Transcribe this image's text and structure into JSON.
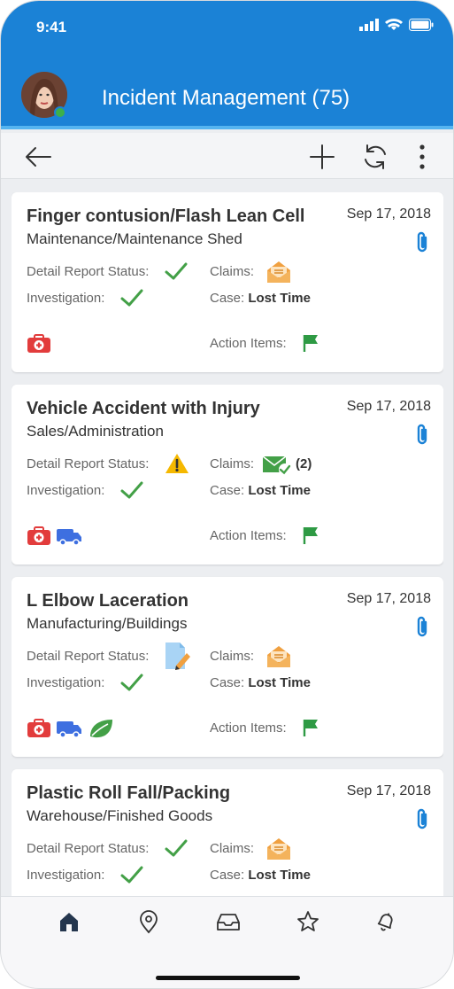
{
  "status_bar": {
    "time": "9:41"
  },
  "header": {
    "title": "Incident Management (75)"
  },
  "labels": {
    "detail_report_status": "Detail Report Status:",
    "investigation": "Investigation:",
    "claims": "Claims:",
    "case": "Case:",
    "action_items": "Action Items:"
  },
  "incidents": [
    {
      "title": "Finger contusion/Flash Lean Cell",
      "location": "Maintenance/Maintenance Shed",
      "date": "Sep 17, 2018",
      "detail_status": "complete-check",
      "claims_icon": "envelope-open-icon",
      "claims_count": "",
      "case_type": "Lost Time",
      "tags": [
        "first-aid-icon"
      ]
    },
    {
      "title": "Vehicle Accident with Injury",
      "location": "Sales/Administration",
      "date": "Sep 17, 2018",
      "detail_status": "warning",
      "claims_icon": "envelope-check-icon",
      "claims_count": "(2)",
      "case_type": "Lost Time",
      "tags": [
        "first-aid-icon",
        "truck-icon"
      ]
    },
    {
      "title": "L Elbow Laceration",
      "location": "Manufacturing/Buildings",
      "date": "Sep 17, 2018",
      "detail_status": "draft",
      "claims_icon": "envelope-open-icon",
      "claims_count": "",
      "case_type": "Lost Time",
      "tags": [
        "first-aid-icon",
        "truck-icon",
        "leaf-icon"
      ]
    },
    {
      "title": "Plastic Roll Fall/Packing",
      "location": "Warehouse/Finished Goods",
      "date": "Sep 17, 2018",
      "detail_status": "complete-check",
      "claims_icon": "envelope-open-icon",
      "claims_count": "",
      "case_type": "Lost Time",
      "tags": []
    }
  ],
  "tabs": [
    "home-icon",
    "location-pin-icon",
    "inbox-icon",
    "star-icon",
    "bell-icon"
  ],
  "colors": {
    "brand_blue": "#1b82d6",
    "check_green": "#43a047",
    "first_aid_red": "#e23c3c",
    "truck_blue": "#3e6fe0",
    "envelope_orange": "#f0a040"
  }
}
